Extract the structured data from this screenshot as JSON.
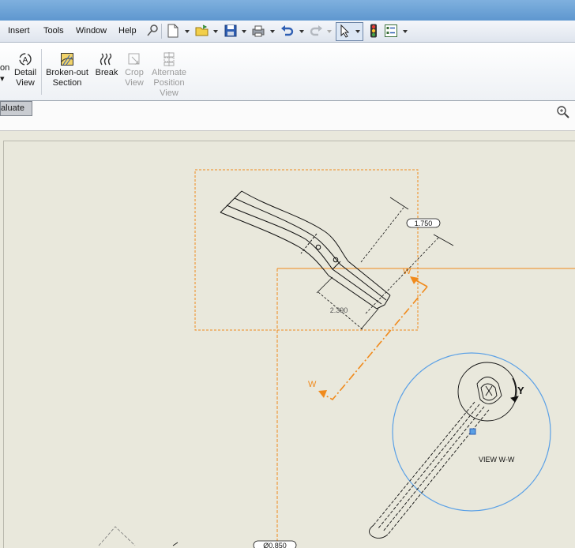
{
  "menu": {
    "items": [
      "Insert",
      "Tools",
      "Window",
      "Help"
    ]
  },
  "ribbon": {
    "partial_label": "on",
    "detail_view": {
      "line1": "Detail",
      "line2": "View",
      "icon_letter": "A"
    },
    "broken_out_section": {
      "line1": "Broken-out",
      "line2": "Section"
    },
    "break": {
      "line1": "Break"
    },
    "crop_view": {
      "line1": "Crop",
      "line2": "View"
    },
    "alternate_position_view": {
      "line1": "Alternate",
      "line2": "Position",
      "line3": "View"
    }
  },
  "tabs": {
    "evaluate_partial": "aluate"
  },
  "drawing": {
    "dim_upper": "1.750",
    "dim_lower": "2.390",
    "dim_bottom": "Ø0.850",
    "section_label_a": "W",
    "section_label_b": "W",
    "axis_label": "Y",
    "view_label": "VIEW W-W"
  },
  "colors": {
    "accent_orange": "#f08a1c",
    "circle_blue": "#5aa0e6"
  }
}
